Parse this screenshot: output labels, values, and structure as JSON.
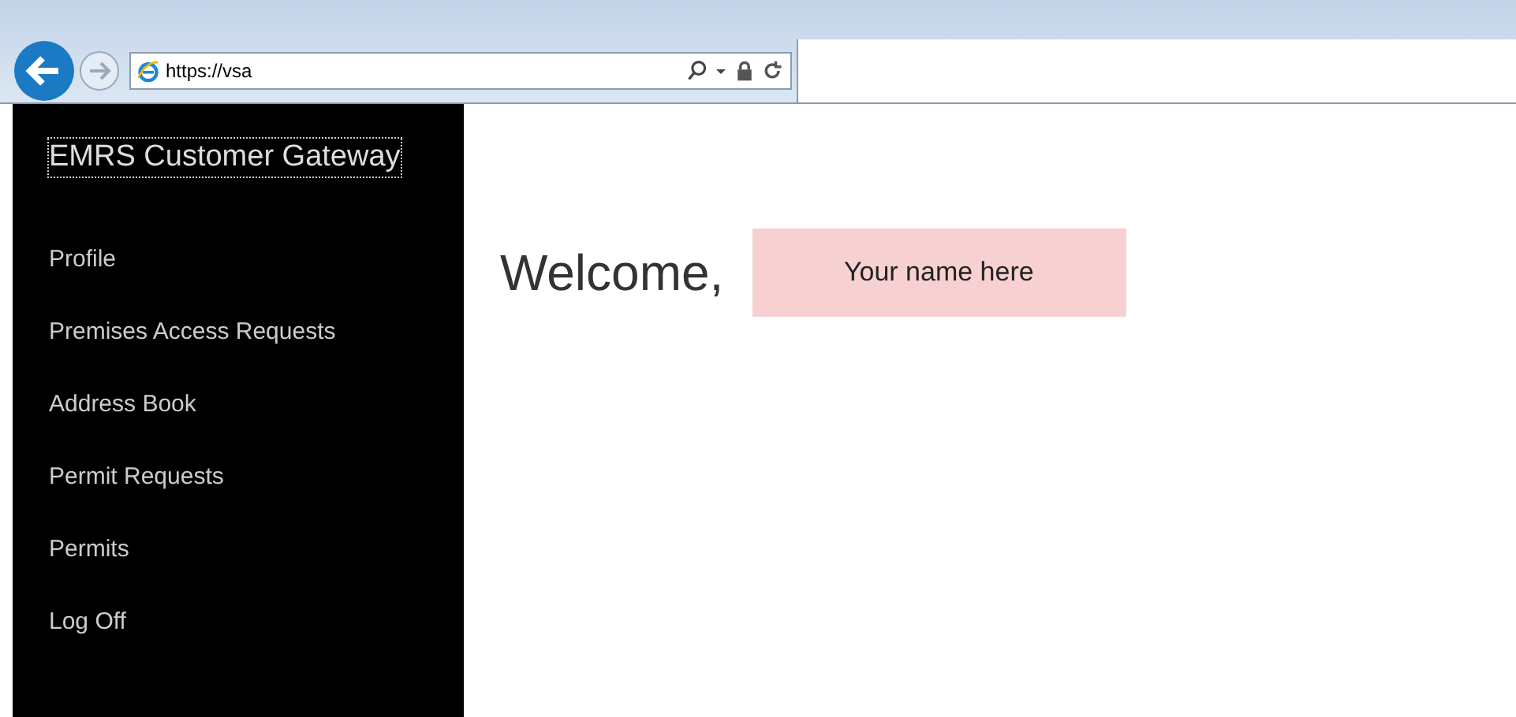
{
  "browser": {
    "url": "https://vsa"
  },
  "sidebar": {
    "brand": "EMRS Customer Gateway",
    "items": [
      {
        "label": "Profile"
      },
      {
        "label": "Premises Access Requests"
      },
      {
        "label": "Address Book"
      },
      {
        "label": "Permit Requests"
      },
      {
        "label": "Permits"
      },
      {
        "label": "Log Off"
      }
    ]
  },
  "main": {
    "greeting": "Welcome,",
    "name": "Your name here"
  }
}
